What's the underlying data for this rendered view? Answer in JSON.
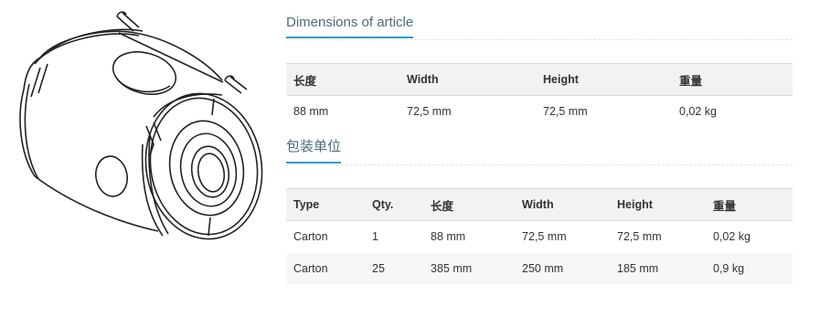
{
  "product_image": {
    "alt": ""
  },
  "dimensions": {
    "heading": "Dimensions of article",
    "columns": [
      "长度",
      "Width",
      "Height",
      "重量"
    ],
    "row": [
      "88 mm",
      "72,5 mm",
      "72,5 mm",
      "0,02 kg"
    ]
  },
  "packaging": {
    "heading": "包装单位",
    "columns": [
      "Type",
      "Qty.",
      "长度",
      "Width",
      "Height",
      "重量"
    ],
    "rows": [
      [
        "Carton",
        "1",
        "88 mm",
        "72,5 mm",
        "72,5 mm",
        "0,02 kg"
      ],
      [
        "Carton",
        "25",
        "385 mm",
        "250 mm",
        "185 mm",
        "0,9 kg"
      ]
    ]
  }
}
